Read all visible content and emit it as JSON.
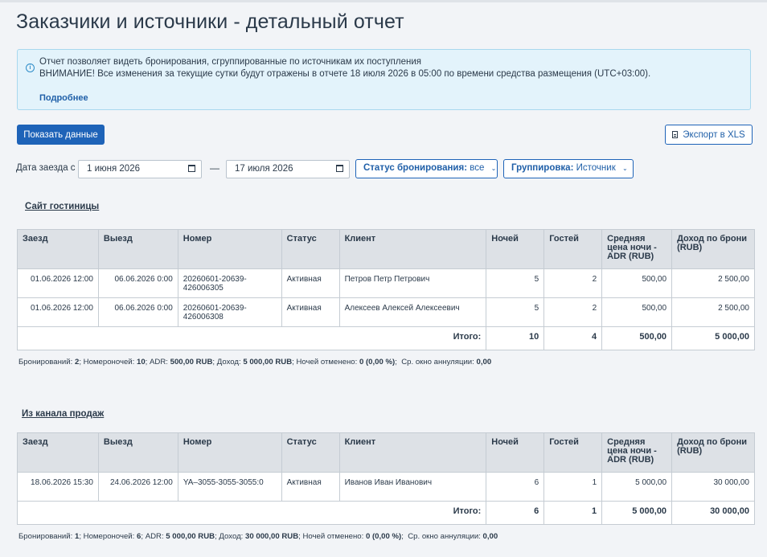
{
  "page": {
    "title": "Заказчики и источники - детальный отчет"
  },
  "info": {
    "line1": "Отчет позволяет видеть бронирования, сгруппированные по источникам их поступления",
    "line2": "ВНИМАНИЕ! Все изменения за текущие сутки будут отражены в отчете 18 июля 2026 в 05:00 по времени средства размещения (UTC+03:00).",
    "more_link": "Подробнее",
    "icon": "info-icon"
  },
  "toolbar": {
    "show_data_label": "Показать данные",
    "export_label": "Экспорт в XLS"
  },
  "filters": {
    "date_label": "Дата заезда с",
    "date_from": "1 июня 2026",
    "date_to": "17 июля 2026",
    "separator": "—",
    "status_label": "Статус бронирования:",
    "status_value": "все",
    "grouping_label": "Группировка:",
    "grouping_value": "Источник"
  },
  "columns": [
    "Заезд",
    "Выезд",
    "Номер",
    "Статус",
    "Клиент",
    "Ночей",
    "Гостей",
    "Средняя цена ночи - ADR (RUB)",
    "Доход по брони (RUB)"
  ],
  "groups": [
    {
      "title": "Сайт гостиницы",
      "rows": [
        {
          "checkin": "01.06.2026 12:00",
          "checkout": "06.06.2026 0:00",
          "number": "20260601-20639-426006305",
          "status": "Активная",
          "client": "Петров Петр Петрович",
          "nights": "5",
          "guests": "2",
          "adr": "500,00",
          "revenue": "2 500,00"
        },
        {
          "checkin": "01.06.2026 12:00",
          "checkout": "06.06.2026 0:00",
          "number": "20260601-20639-426006308",
          "status": "Активная",
          "client": "Алексеев Алексей Алексеевич",
          "nights": "5",
          "guests": "2",
          "adr": "500,00",
          "revenue": "2 500,00"
        }
      ],
      "total": {
        "label": "Итого:",
        "nights": "10",
        "guests": "4",
        "adr": "500,00",
        "revenue": "5 000,00"
      },
      "summary": {
        "bookings_label": "Бронирований:",
        "bookings": "2",
        "room_nights_label": "Номероночей:",
        "room_nights": "10",
        "adr_label": "ADR:",
        "adr": "500,00 RUB",
        "income_label": "Доход:",
        "income": "5 000,00 RUB",
        "cancelled_label": "Ночей отменено:",
        "cancelled": "0 (0,00 %)",
        "window_label": "Ср. окно аннуляции:",
        "window": "0,00"
      }
    },
    {
      "title": "Из канала продаж",
      "rows": [
        {
          "checkin": "18.06.2026 15:30",
          "checkout": "24.06.2026 12:00",
          "number": "YA–3055-3055-3055:0",
          "status": "Активная",
          "client": "Иванов Иван Иванович",
          "nights": "6",
          "guests": "1",
          "adr": "5 000,00",
          "revenue": "30 000,00"
        }
      ],
      "total": {
        "label": "Итого:",
        "nights": "6",
        "guests": "1",
        "adr": "5 000,00",
        "revenue": "30 000,00"
      },
      "summary": {
        "bookings_label": "Бронирований:",
        "bookings": "1",
        "room_nights_label": "Номероночей:",
        "room_nights": "6",
        "adr_label": "ADR:",
        "adr": "5 000,00 RUB",
        "income_label": "Доход:",
        "income": "30 000,00 RUB",
        "cancelled_label": "Ночей отменено:",
        "cancelled": "0 (0,00 %)",
        "window_label": "Ср. окно аннуляции:",
        "window": "0,00"
      }
    }
  ]
}
